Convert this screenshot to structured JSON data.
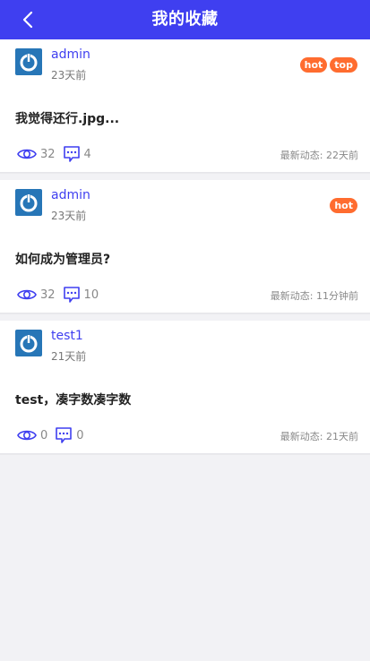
{
  "header": {
    "title": "我的收藏",
    "back_icon": "chevron-left-icon"
  },
  "colors": {
    "accent": "#3f3ff0",
    "badge": "#ff6c2f",
    "avatar": "#2776b7"
  },
  "posts": [
    {
      "username": "admin",
      "time": "23天前",
      "badges": [
        "hot",
        "top"
      ],
      "title": "我觉得还行.jpg...",
      "views": "32",
      "comments": "4",
      "latest": "最新动态: 22天前"
    },
    {
      "username": "admin",
      "time": "23天前",
      "badges": [
        "hot"
      ],
      "title": "如何成为管理员?",
      "views": "32",
      "comments": "10",
      "latest": "最新动态: 11分钟前"
    },
    {
      "username": "test1",
      "time": "21天前",
      "badges": [],
      "title": "test，凑字数凑字数",
      "views": "0",
      "comments": "0",
      "latest": "最新动态: 21天前"
    }
  ]
}
